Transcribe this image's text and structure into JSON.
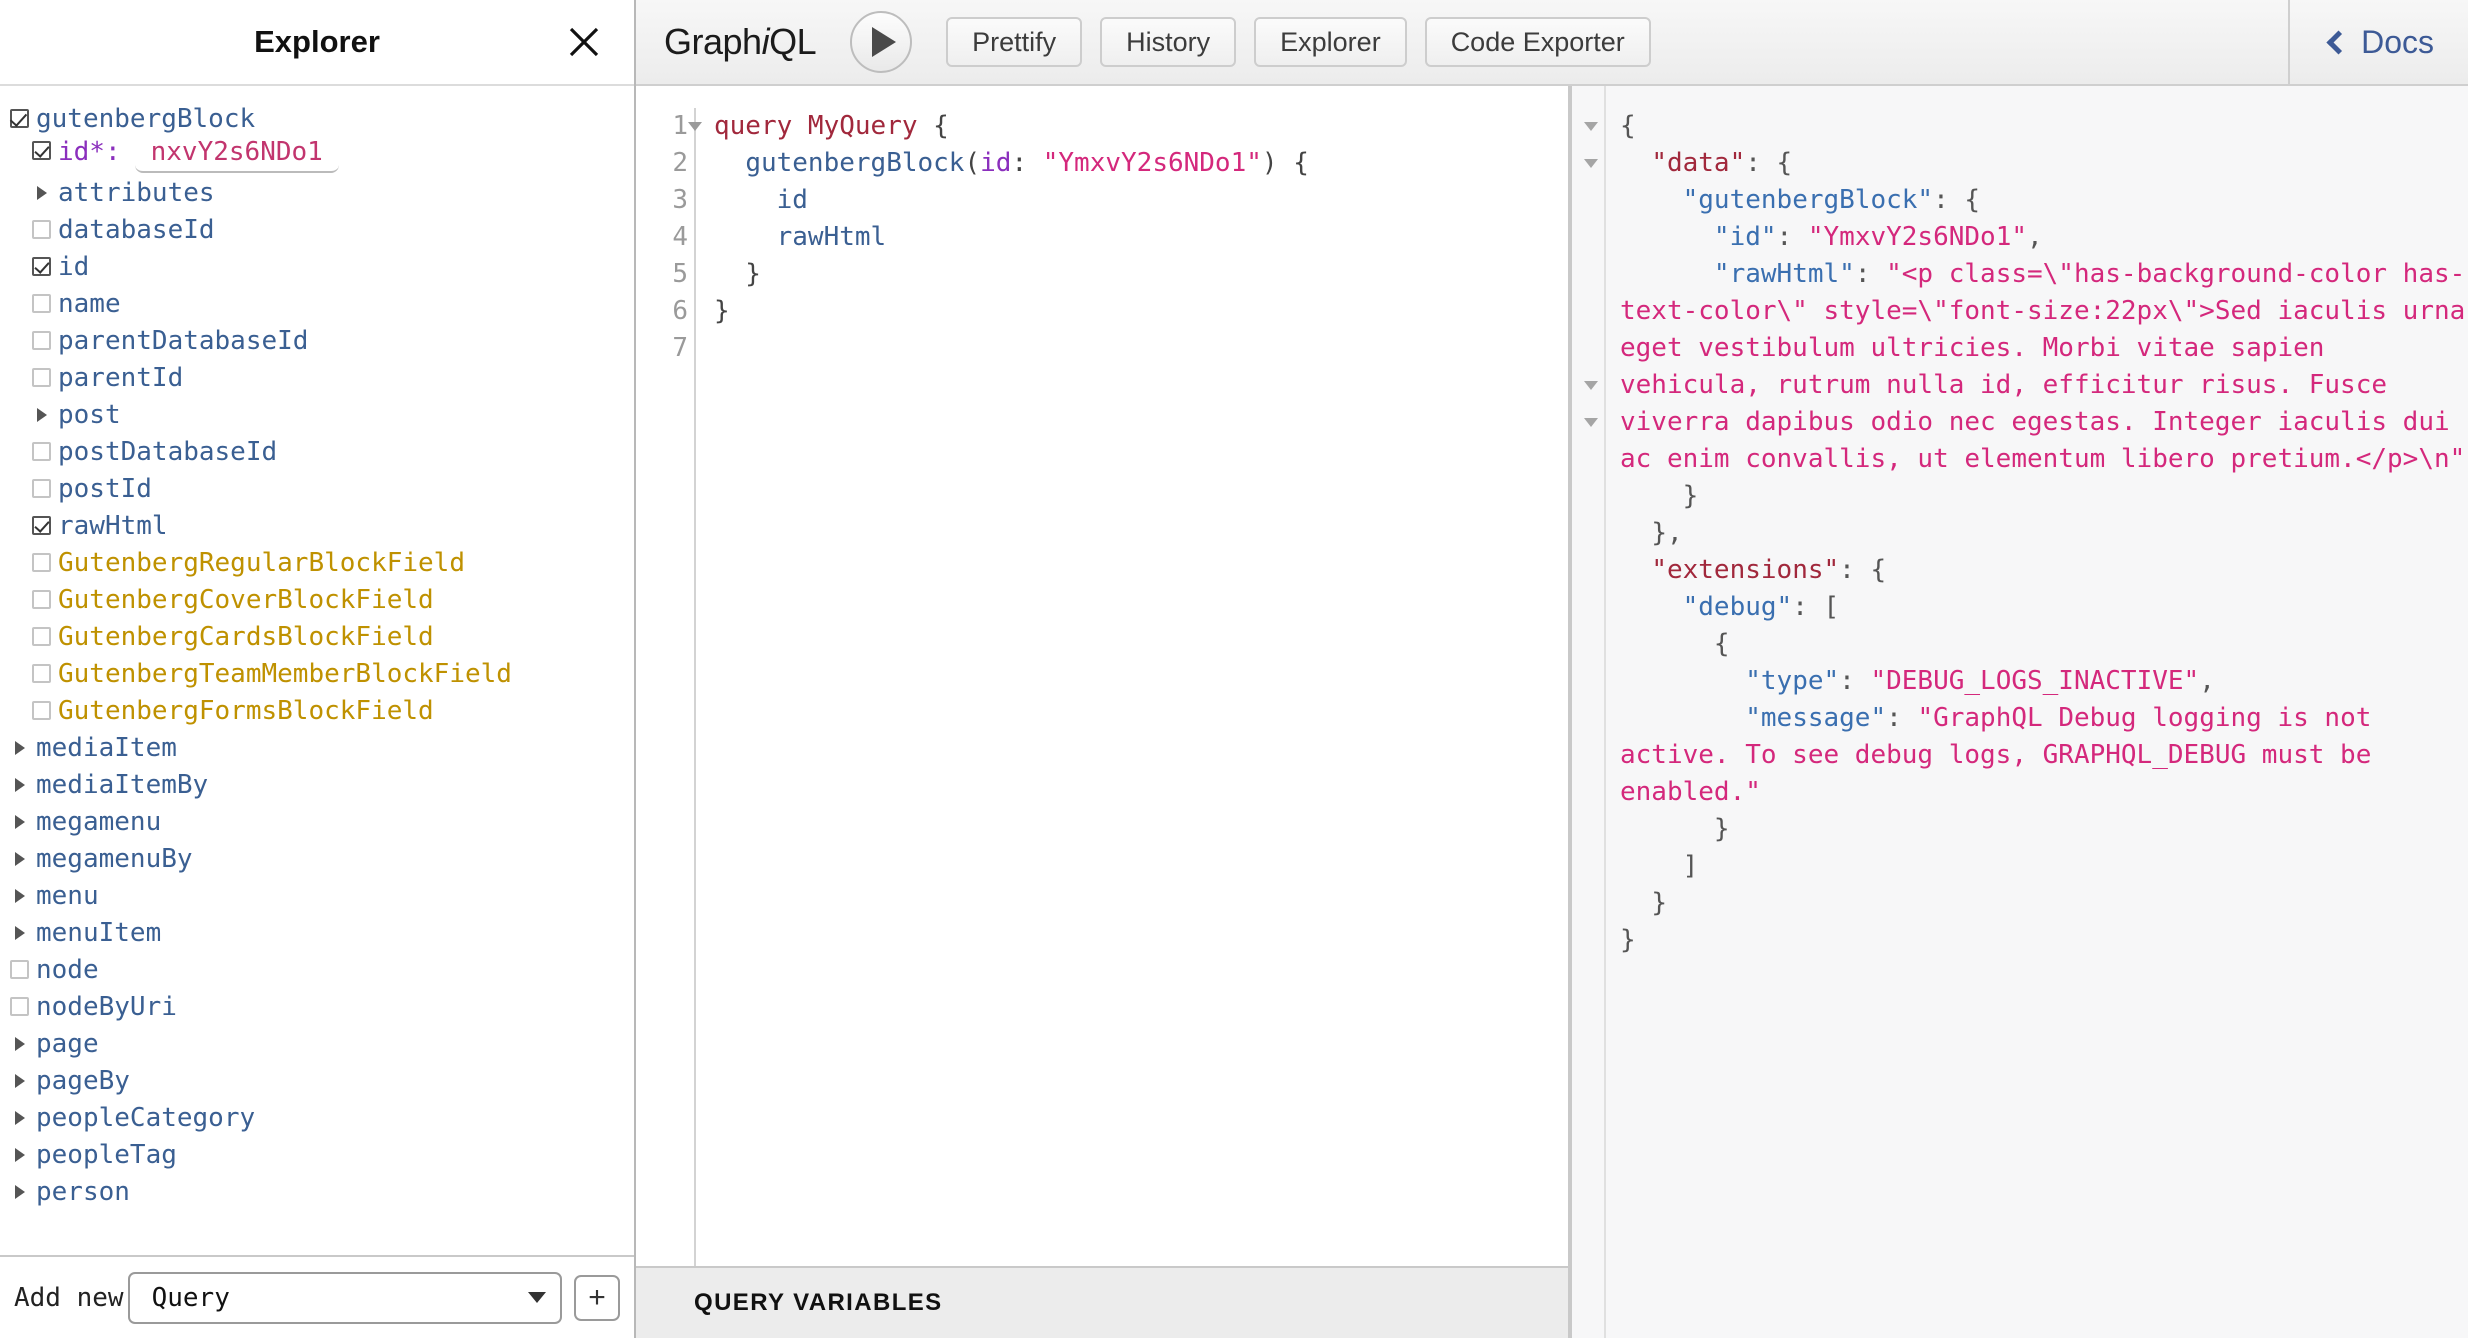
{
  "explorer": {
    "title": "Explorer",
    "close_icon": "close-icon",
    "tree": {
      "root_field": {
        "label": "gutenbergBlock",
        "checked": true,
        "state": "half"
      },
      "argument": {
        "label": "id*:",
        "value": "nxvY2s6NDo1",
        "checked": true
      },
      "children": [
        {
          "label": "attributes",
          "type": "expandable",
          "kind": "field"
        },
        {
          "label": "databaseId",
          "type": "checkbox",
          "checked": false,
          "kind": "field"
        },
        {
          "label": "id",
          "type": "checkbox",
          "checked": true,
          "kind": "field"
        },
        {
          "label": "name",
          "type": "checkbox",
          "checked": false,
          "kind": "field"
        },
        {
          "label": "parentDatabaseId",
          "type": "checkbox",
          "checked": false,
          "kind": "field"
        },
        {
          "label": "parentId",
          "type": "checkbox",
          "checked": false,
          "kind": "field"
        },
        {
          "label": "post",
          "type": "expandable",
          "kind": "field"
        },
        {
          "label": "postDatabaseId",
          "type": "checkbox",
          "checked": false,
          "kind": "field"
        },
        {
          "label": "postId",
          "type": "checkbox",
          "checked": false,
          "kind": "field"
        },
        {
          "label": "rawHtml",
          "type": "checkbox",
          "checked": true,
          "kind": "field"
        },
        {
          "label": "GutenbergRegularBlockField",
          "type": "checkbox",
          "checked": false,
          "kind": "fragment"
        },
        {
          "label": "GutenbergCoverBlockField",
          "type": "checkbox",
          "checked": false,
          "kind": "fragment"
        },
        {
          "label": "GutenbergCardsBlockField",
          "type": "checkbox",
          "checked": false,
          "kind": "fragment"
        },
        {
          "label": "GutenbergTeamMemberBlockField",
          "type": "checkbox",
          "checked": false,
          "kind": "fragment"
        },
        {
          "label": "GutenbergFormsBlockField",
          "type": "checkbox",
          "checked": false,
          "kind": "fragment"
        }
      ],
      "root_fields": [
        {
          "label": "mediaItem",
          "type": "expandable"
        },
        {
          "label": "mediaItemBy",
          "type": "expandable"
        },
        {
          "label": "megamenu",
          "type": "expandable"
        },
        {
          "label": "megamenuBy",
          "type": "expandable"
        },
        {
          "label": "menu",
          "type": "expandable"
        },
        {
          "label": "menuItem",
          "type": "expandable"
        },
        {
          "label": "node",
          "type": "checkbox",
          "checked": false
        },
        {
          "label": "nodeByUri",
          "type": "checkbox",
          "checked": false
        },
        {
          "label": "page",
          "type": "expandable"
        },
        {
          "label": "pageBy",
          "type": "expandable"
        },
        {
          "label": "peopleCategory",
          "type": "expandable"
        },
        {
          "label": "peopleTag",
          "type": "expandable"
        },
        {
          "label": "person",
          "type": "expandable"
        }
      ]
    },
    "footer": {
      "add_new_label": "Add new",
      "select_value": "Query",
      "plus_label": "+"
    }
  },
  "toolbar": {
    "brand_prefix": "Graph",
    "brand_italic": "i",
    "brand_suffix": "QL",
    "execute_icon": "play-icon",
    "prettify_label": "Prettify",
    "history_label": "History",
    "explorer_label": "Explorer",
    "code_exporter_label": "Code Exporter",
    "docs_label": "Docs",
    "docs_icon": "chevron-left-icon"
  },
  "editor": {
    "line_numbers": [
      "1",
      "2",
      "3",
      "4",
      "5",
      "6",
      "7"
    ],
    "query_lines": [
      {
        "n": 1,
        "tokens": [
          {
            "t": "query ",
            "c": "k-kw"
          },
          {
            "t": "MyQuery",
            "c": "k-name"
          },
          {
            "t": " {",
            "c": "k-punc"
          }
        ]
      },
      {
        "n": 2,
        "tokens": [
          {
            "t": "  ",
            "c": "k-punc"
          },
          {
            "t": "gutenbergBlock",
            "c": "k-field"
          },
          {
            "t": "(",
            "c": "k-punc"
          },
          {
            "t": "id",
            "c": "k-arg"
          },
          {
            "t": ": ",
            "c": "k-punc"
          },
          {
            "t": "\"YmxvY2s6NDo1\"",
            "c": "k-str"
          },
          {
            "t": ") {",
            "c": "k-punc"
          }
        ]
      },
      {
        "n": 3,
        "tokens": [
          {
            "t": "    ",
            "c": "k-punc"
          },
          {
            "t": "id",
            "c": "k-field"
          }
        ]
      },
      {
        "n": 4,
        "tokens": [
          {
            "t": "    ",
            "c": "k-punc"
          },
          {
            "t": "rawHtml",
            "c": "k-field"
          }
        ]
      },
      {
        "n": 5,
        "tokens": [
          {
            "t": "  }",
            "c": "k-punc"
          }
        ]
      },
      {
        "n": 6,
        "tokens": [
          {
            "t": "}",
            "c": "k-punc"
          }
        ]
      }
    ],
    "query_variables_label": "QUERY VARIABLES"
  },
  "response": {
    "lines": [
      {
        "tokens": [
          {
            "t": "{",
            "c": "j-p"
          }
        ]
      },
      {
        "tokens": [
          {
            "t": "  ",
            "c": "j-p"
          },
          {
            "t": "\"data\"",
            "c": "j-key1"
          },
          {
            "t": ": {",
            "c": "j-p"
          }
        ]
      },
      {
        "tokens": [
          {
            "t": "    ",
            "c": "j-p"
          },
          {
            "t": "\"gutenbergBlock\"",
            "c": "j-key2"
          },
          {
            "t": ": {",
            "c": "j-p"
          }
        ]
      },
      {
        "tokens": [
          {
            "t": "      ",
            "c": "j-p"
          },
          {
            "t": "\"id\"",
            "c": "j-key2"
          },
          {
            "t": ": ",
            "c": "j-p"
          },
          {
            "t": "\"YmxvY2s6NDo1\"",
            "c": "j-str"
          },
          {
            "t": ",",
            "c": "j-p"
          }
        ]
      },
      {
        "tokens": [
          {
            "t": "      ",
            "c": "j-p"
          },
          {
            "t": "\"rawHtml\"",
            "c": "j-key2"
          },
          {
            "t": ": ",
            "c": "j-p"
          },
          {
            "t": "\"<p class=\\\"has-background-color has-text-color\\\" style=\\\"font-size:22px\\\">Sed iaculis urna eget vestibulum ultricies. Morbi vitae sapien vehicula, rutrum nulla id, efficitur risus. Fusce viverra dapibus odio nec egestas. Integer iaculis dui ac enim convallis, ut elementum libero pretium.</p>\\n\"",
            "c": "j-str"
          }
        ]
      },
      {
        "tokens": [
          {
            "t": "    }",
            "c": "j-p"
          }
        ]
      },
      {
        "tokens": [
          {
            "t": "  },",
            "c": "j-p"
          }
        ]
      },
      {
        "tokens": [
          {
            "t": "  ",
            "c": "j-p"
          },
          {
            "t": "\"extensions\"",
            "c": "j-key1"
          },
          {
            "t": ": {",
            "c": "j-p"
          }
        ]
      },
      {
        "tokens": [
          {
            "t": "    ",
            "c": "j-p"
          },
          {
            "t": "\"debug\"",
            "c": "j-key2"
          },
          {
            "t": ": [",
            "c": "j-p"
          }
        ]
      },
      {
        "tokens": [
          {
            "t": "      {",
            "c": "j-p"
          }
        ]
      },
      {
        "tokens": [
          {
            "t": "        ",
            "c": "j-p"
          },
          {
            "t": "\"type\"",
            "c": "j-key2"
          },
          {
            "t": ": ",
            "c": "j-p"
          },
          {
            "t": "\"DEBUG_LOGS_INACTIVE\"",
            "c": "j-str"
          },
          {
            "t": ",",
            "c": "j-p"
          }
        ]
      },
      {
        "tokens": [
          {
            "t": "        ",
            "c": "j-p"
          },
          {
            "t": "\"message\"",
            "c": "j-key2"
          },
          {
            "t": ": ",
            "c": "j-p"
          },
          {
            "t": "\"GraphQL Debug logging is not active. To see debug logs, GRAPHQL_DEBUG must be enabled.\"",
            "c": "j-str"
          }
        ]
      },
      {
        "tokens": [
          {
            "t": "      }",
            "c": "j-p"
          }
        ]
      },
      {
        "tokens": [
          {
            "t": "    ]",
            "c": "j-p"
          }
        ]
      },
      {
        "tokens": [
          {
            "t": "  }",
            "c": "j-p"
          }
        ]
      },
      {
        "tokens": [
          {
            "t": "}",
            "c": "j-p"
          }
        ]
      }
    ]
  }
}
